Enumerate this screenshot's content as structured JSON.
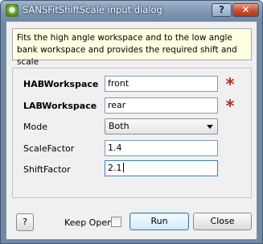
{
  "window": {
    "title": "SANSFitShiftScale input dialog",
    "help_glyph": "?",
    "close_glyph": "✕"
  },
  "description": "Fits the high angle workspace and to the low angle bank workspace and provides the required shift and scale",
  "fields": {
    "hab_workspace": {
      "label": "HABWorkspace",
      "value": "front",
      "required_mark": "*"
    },
    "lab_workspace": {
      "label": "LABWorkspace",
      "value": "rear",
      "required_mark": "*"
    },
    "mode": {
      "label": "Mode",
      "selected": "Both"
    },
    "scale_factor": {
      "label": "ScaleFactor",
      "value": "1.4"
    },
    "shift_factor": {
      "label": "ShiftFactor",
      "value": "2.1"
    }
  },
  "footer": {
    "help_label": "?",
    "keep_open_label": "Keep Open",
    "keep_open_checked": false,
    "run_label": "Run",
    "close_label": "Close"
  },
  "colors": {
    "required_star": "#b5301c",
    "description_bg": "#ffffe1"
  }
}
